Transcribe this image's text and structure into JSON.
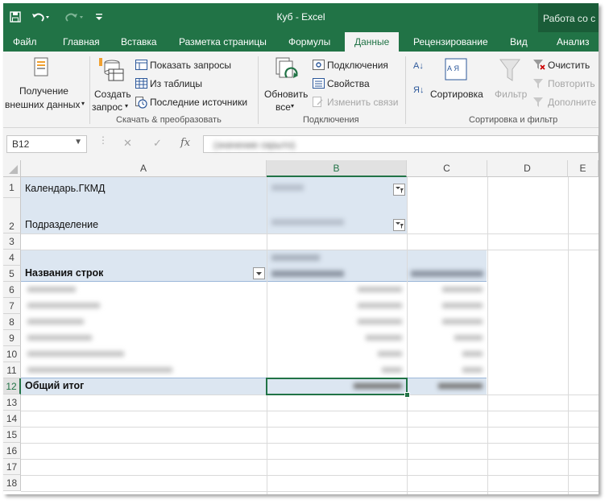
{
  "window": {
    "title": "Куб - Excel",
    "context_tab": "Работа со с"
  },
  "tabs": [
    "Файл",
    "Главная",
    "Вставка",
    "Разметка страницы",
    "Формулы",
    "Данные",
    "Рецензирование",
    "Вид",
    "Анализ"
  ],
  "ribbon": {
    "get_external_1": "Получение",
    "get_external_2": "внешних данных",
    "create_query_1": "Создать",
    "create_query_2": "запрос",
    "show_queries": "Показать запросы",
    "from_table": "Из таблицы",
    "recent_sources": "Последние источники",
    "group_get_transform": "Скачать & преобразовать",
    "refresh_all_1": "Обновить",
    "refresh_all_2": "все",
    "connections": "Подключения",
    "properties": "Свойства",
    "edit_links": "Изменить связи",
    "group_connections": "Подключения",
    "sort_small": "А Я",
    "sort": "Сортировка",
    "filter": "Фильтр",
    "clear": "Очистить",
    "reapply": "Повторить",
    "advanced": "Дополните",
    "group_sort_filter": "Сортировка и фильтр"
  },
  "formula_bar": {
    "name_box": "B12",
    "fx": "fx",
    "content": "(значение скрыто)"
  },
  "columns": [
    "A",
    "B",
    "C",
    "D",
    "E"
  ],
  "rows": [
    "1",
    "2",
    "3",
    "4",
    "5",
    "6",
    "7",
    "8",
    "9",
    "10",
    "11",
    "12",
    "13",
    "14",
    "15",
    "16",
    "17",
    "18"
  ],
  "cells": {
    "a1": "Календарь.ГКМД",
    "a2": "Подразделение",
    "a5": "Названия строк",
    "a12": "Общий итог"
  },
  "colors": {
    "excel_green": "#217346",
    "pivot_fill": "#dce6f1"
  }
}
